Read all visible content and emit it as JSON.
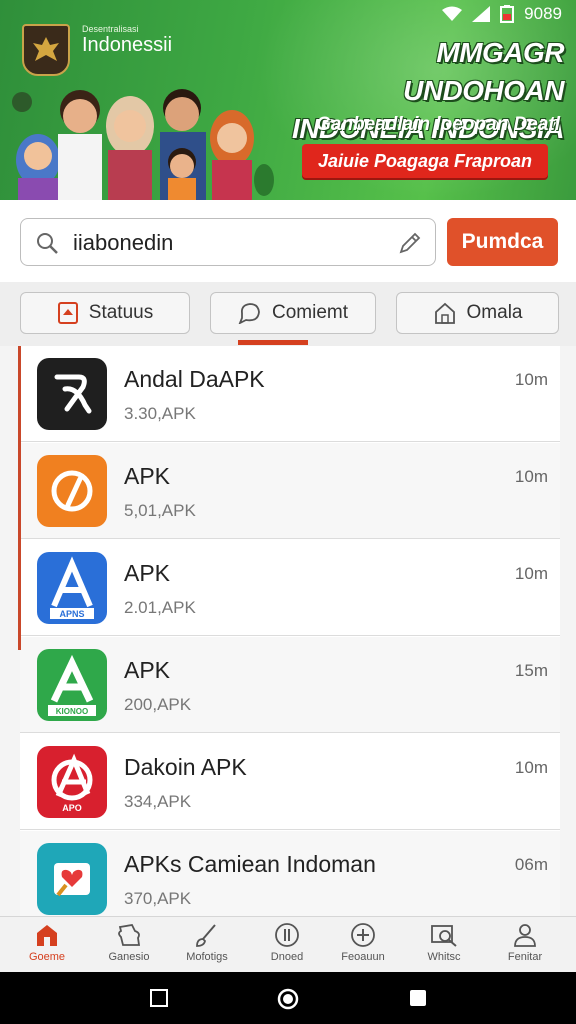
{
  "status_bar": {
    "time": "9089"
  },
  "banner": {
    "brand_small": "Desentralisasi",
    "brand": "Indonessii",
    "headline_line1": "MMGAGR UNDOHOAN",
    "headline_line2": "INDONEIA INDONSIA",
    "subline": "Ganbeadlain loeopan Deatl",
    "promo_button": "Jaiuie Poagaga Fraproan",
    "colors": {
      "green": "#3ea843",
      "red": "#e0261c"
    }
  },
  "search": {
    "value": "iiabonedin",
    "button_label": "Pumdca",
    "accent": "#e0512a"
  },
  "tabs": [
    {
      "label": "Statuus",
      "icon": "status-icon"
    },
    {
      "label": "Comiemt",
      "icon": "comment-icon"
    },
    {
      "label": "Omala",
      "icon": "home-icon"
    }
  ],
  "apps": [
    {
      "name": "Andal DaAPK",
      "sub": "3.30,APK",
      "time": "10m",
      "icon": "black-tool-icon",
      "color": "#1f1f1f"
    },
    {
      "name": "APK",
      "sub": "5,01,APK",
      "time": "10m",
      "icon": "orange-compass-icon",
      "color": "#f08020"
    },
    {
      "name": "APK",
      "sub": "2.01,APK",
      "time": "10m",
      "icon": "blue-apk-icon",
      "color": "#2a6fd8",
      "badge": "APNS"
    },
    {
      "name": "APK",
      "sub": "200,APK",
      "time": "15m",
      "icon": "green-apk-icon",
      "color": "#2fa84a",
      "badge": "KIONOO"
    },
    {
      "name": "Dakoin APK",
      "sub": "334,APK",
      "time": "10m",
      "icon": "red-apk-icon",
      "color": "#d8202e",
      "badge": "APO"
    },
    {
      "name": "APKs Camiean Indoman",
      "sub": "370,APK",
      "time": "06m",
      "icon": "teal-heart-icon",
      "color": "#1fa7b8"
    }
  ],
  "bottom_nav": [
    {
      "label": "Goeme",
      "icon": "home-icon",
      "active": true
    },
    {
      "label": "Ganesio",
      "icon": "puzzle-icon"
    },
    {
      "label": "Mofotigs",
      "icon": "brush-icon"
    },
    {
      "label": "Dnoed",
      "icon": "info-icon"
    },
    {
      "label": "Feoauun",
      "icon": "plus-circle-icon"
    },
    {
      "label": "Whitsc",
      "icon": "search-box-icon"
    },
    {
      "label": "Fenitar",
      "icon": "user-icon"
    }
  ]
}
